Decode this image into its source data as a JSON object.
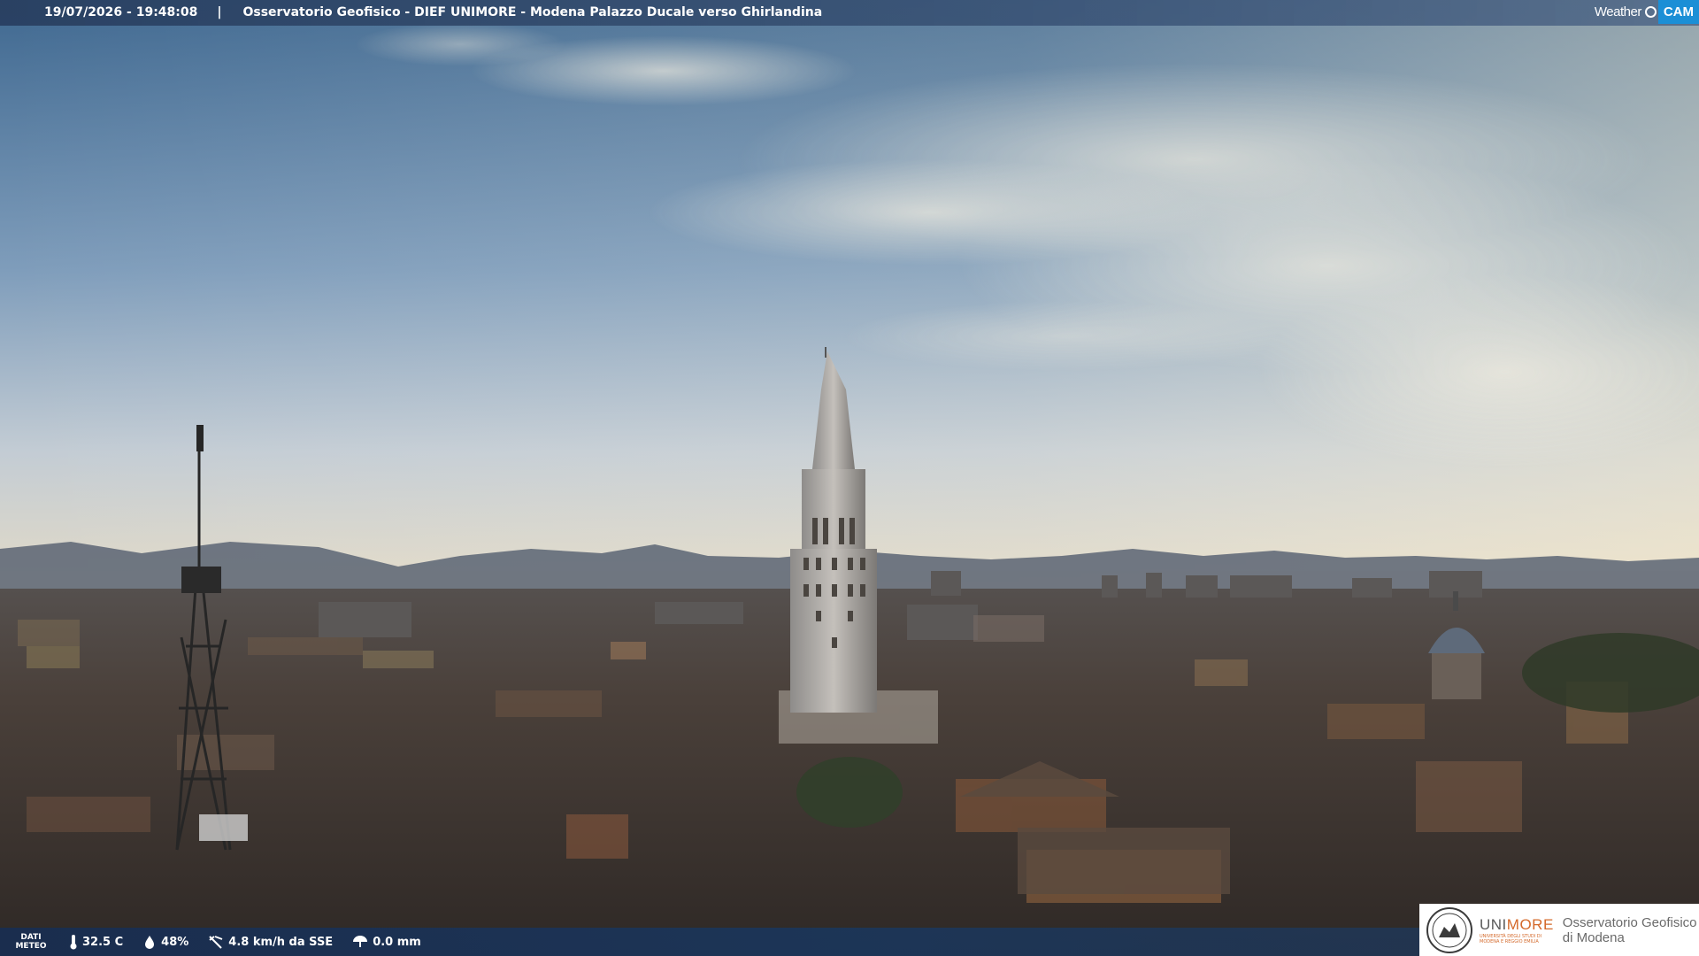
{
  "overlay": {
    "timestamp": "19/07/2026 - 19:48:08",
    "separator": "|",
    "caption": "Osservatorio Geofisico - DIEF UNIMORE - Modena Palazzo Ducale verso Ghirlandina",
    "brand_left": "Weather",
    "brand_right": "CAM"
  },
  "weather": {
    "label_line1": "DATI",
    "label_line2": "METEO",
    "temperature": "32.5 C",
    "humidity": "48%",
    "wind": "4.8 km/h da SSE",
    "rain": "0.0 mm"
  },
  "logo": {
    "uni_part1": "UNI",
    "uni_part2": "MORE",
    "uni_subtitle": "UNIVERSITÀ DEGLI STUDI DI MODENA E REGGIO EMILIA",
    "observatory_line1": "Osservatorio Geofisico",
    "observatory_line2": "di Modena"
  },
  "colors": {
    "sky_top": "#3f6890",
    "sky_mid": "#8aa8c6",
    "horizon": "#e6dcc6",
    "mountains": "#4a5566",
    "city": "#3b3430",
    "bar": "#1f3b66",
    "accent_orange": "#d4692a",
    "cam_blue": "#1b8fd6"
  }
}
